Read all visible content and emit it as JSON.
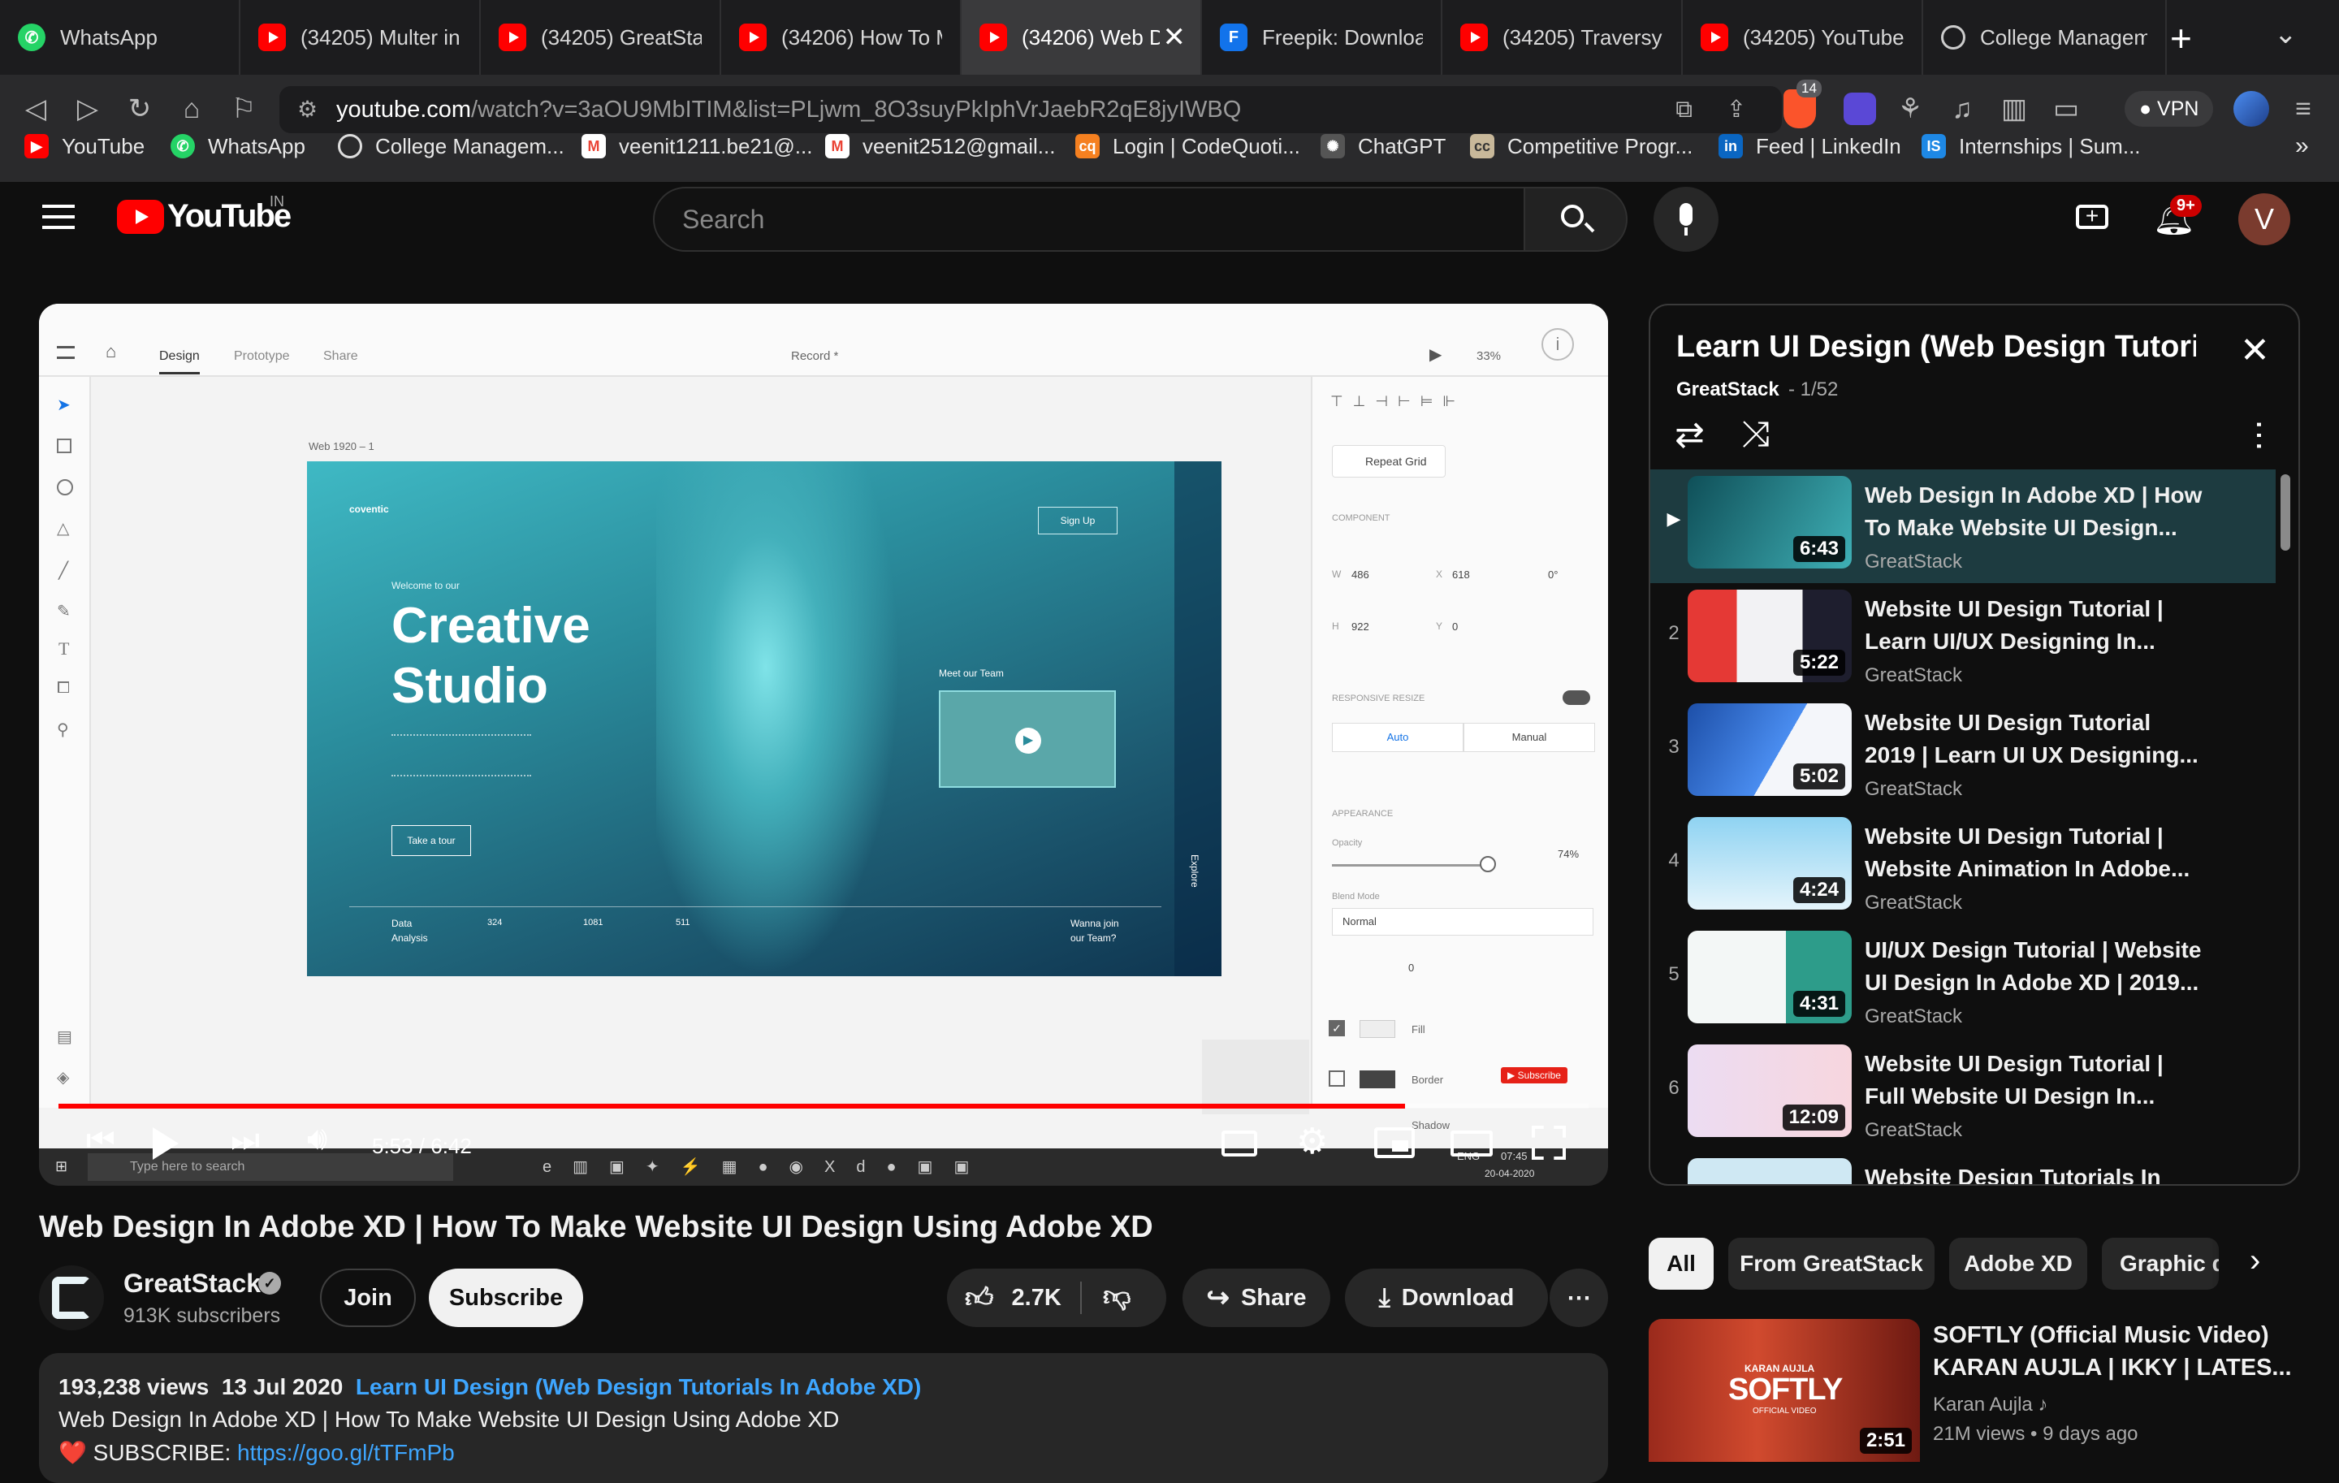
{
  "tabs": [
    {
      "label": "WhatsApp",
      "icon": "whatsapp-icon"
    },
    {
      "label": "(34205) Multer in N",
      "icon": "youtube-icon"
    },
    {
      "label": "(34205) GreatStack",
      "icon": "youtube-icon"
    },
    {
      "label": "(34206) How To Ma",
      "icon": "youtube-icon"
    },
    {
      "label": "(34206) Web D",
      "icon": "youtube-icon",
      "active": true
    },
    {
      "label": "Freepik: Download",
      "icon": "freepik-icon"
    },
    {
      "label": "(34205) Traversy M",
      "icon": "youtube-icon"
    },
    {
      "label": "(34205) YouTube",
      "icon": "youtube-icon"
    },
    {
      "label": "College Manageme",
      "icon": "globe-icon"
    }
  ],
  "address": {
    "domain": "youtube.com",
    "path": "/watch?v=3aOU9MbITIM&list=PLjwm_8O3suyPkIphVrJaebR2qE8jyIWBQ",
    "brave_count": "14",
    "vpn_label": "VPN"
  },
  "bookmarks": [
    {
      "label": "YouTube",
      "icon": "youtube-icon"
    },
    {
      "label": "WhatsApp",
      "icon": "whatsapp-icon"
    },
    {
      "label": "College Managem...",
      "icon": "globe-icon"
    },
    {
      "label": "veenit1211.be21@...",
      "icon": "gmail-icon"
    },
    {
      "label": "veenit2512@gmail...",
      "icon": "gmail-icon"
    },
    {
      "label": "Login | CodeQuoti...",
      "icon": "codequotient-icon"
    },
    {
      "label": "ChatGPT",
      "icon": "chatgpt-icon"
    },
    {
      "label": "Competitive Progr...",
      "icon": "cc-icon"
    },
    {
      "label": "Feed | LinkedIn",
      "icon": "linkedin-icon"
    },
    {
      "label": "Internships | Sum...",
      "icon": "is-icon"
    }
  ],
  "youtube": {
    "logo_text": "YouTube",
    "region": "IN",
    "search_placeholder": "Search",
    "notif_count": "9+",
    "avatar_letter": "V"
  },
  "player": {
    "time": "5:53 / 6:42",
    "progress": 0.88,
    "xd": {
      "tab_design": "Design",
      "tab_prototype": "Prototype",
      "tab_share": "Share",
      "record": "Record *",
      "zoom": "33%",
      "artboard": "Web 1920 – 1",
      "brand": "coventic",
      "signup": "Sign Up",
      "welcome": "Welcome to our",
      "headline1": "Creative",
      "headline2": "Studio",
      "tour": "Take a tour",
      "meet": "Meet our Team",
      "footer_data": "Data",
      "footer_analysis": "Analysis",
      "n1": "324",
      "n2": "1081",
      "n3": "511",
      "join1": "Wanna join",
      "join2": "our Team?",
      "explore": "Explore",
      "repeat_grid": "Repeat Grid",
      "component": "COMPONENT",
      "w_label": "W",
      "w_val": "486",
      "x_label": "X",
      "x_val": "618",
      "h_label": "H",
      "h_val": "922",
      "y_label": "Y",
      "y_val": "0",
      "rot": "0°",
      "resp": "RESPONSIVE RESIZE",
      "auto": "Auto",
      "manual": "Manual",
      "appearance": "APPEARANCE",
      "opacity": "Opacity",
      "opacity_val": "74%",
      "blend": "Blend Mode",
      "blend_val": "Normal",
      "radius_val": "0",
      "fill": "Fill",
      "border": "Border",
      "shadow": "Shadow",
      "subscribe_overlay": "Subscribe",
      "taskbar_search": "Type here to search",
      "clock_time": "07:45",
      "clock_date": "20-04-2020",
      "lang": "ENG"
    }
  },
  "playlist": {
    "title": "Learn UI Design (Web Design Tutori...",
    "channel": "GreatStack",
    "position": "- 1/52",
    "items": [
      {
        "num": "",
        "title": "Web Design In Adobe XD | How To Make Website UI Design...",
        "channel": "GreatStack",
        "duration": "6:43",
        "thumb": "#1f6f74"
      },
      {
        "num": "2",
        "title": "Website UI Design Tutorial | Learn UI/UX Designing In...",
        "channel": "GreatStack",
        "duration": "5:22",
        "thumb": "#e9e9ee"
      },
      {
        "num": "3",
        "title": "Website UI Design Tutorial 2019 | Learn UI UX Designing...",
        "channel": "GreatStack",
        "duration": "5:02",
        "thumb": "#2d6fd6"
      },
      {
        "num": "4",
        "title": "Website UI Design Tutorial | Website Animation In Adobe...",
        "channel": "GreatStack",
        "duration": "4:24",
        "thumb": "#bfe6f5"
      },
      {
        "num": "5",
        "title": "UI/UX Design Tutorial | Website UI Design In Adobe XD | 2019...",
        "channel": "GreatStack",
        "duration": "4:31",
        "thumb": "#e8f3f0"
      },
      {
        "num": "6",
        "title": "Website UI Design Tutorial | Full Website UI Design In...",
        "channel": "GreatStack",
        "duration": "12:09",
        "thumb": "#f1e6ef"
      },
      {
        "num": "",
        "title": "Website Design Tutorials In",
        "channel": "",
        "duration": "",
        "thumb": "#cfe8f3"
      }
    ]
  },
  "video": {
    "title": "Web Design In Adobe XD | How To Make Website UI Design Using Adobe XD",
    "channel": "GreatStack",
    "subscribers": "913K subscribers",
    "join": "Join",
    "subscribe": "Subscribe",
    "likes": "2.7K",
    "share": "Share",
    "download": "Download",
    "views": "193,238 views",
    "date": "13 Jul 2020",
    "playlist_link": "Learn UI Design (Web Design Tutorials In Adobe XD)",
    "desc_line": "Web Design In Adobe XD | How To Make Website UI Design Using Adobe XD",
    "subscribe_line": "❤️ SUBSCRIBE: ",
    "subscribe_url": "https://goo.gl/tTFmPb"
  },
  "chips": [
    "All",
    "From GreatStack",
    "Adobe XD",
    "Graphic d"
  ],
  "recommended": {
    "title": "SOFTLY (Official Music Video) KARAN AUJLA | IKKY | LATES...",
    "channel": "Karan Aujla",
    "meta": "21M views • 9 days ago",
    "duration": "2:51",
    "thumb_text": "SOFTLY",
    "thumb_small": "KARAN AUJLA",
    "thumb_sub": "OFFICIAL VIDEO"
  },
  "colors": {
    "accent_red": "#ff0000",
    "link_blue": "#3ea6ff",
    "bg": "#0f0f0f"
  }
}
